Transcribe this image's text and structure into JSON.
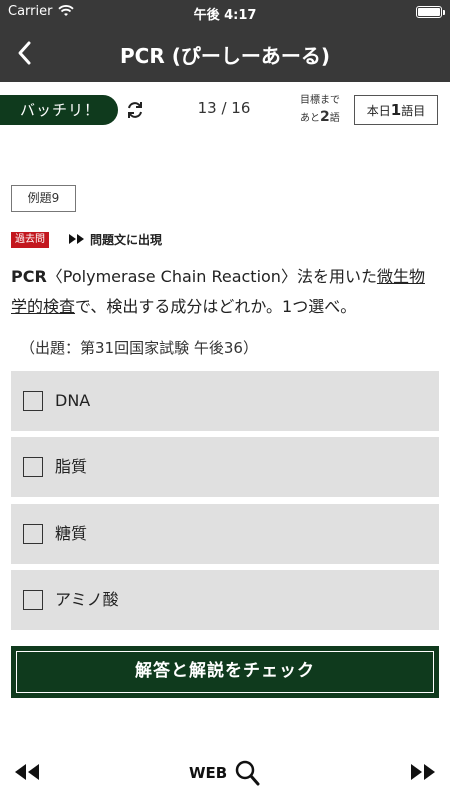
{
  "status_bar": {
    "carrier": "Carrier",
    "time": "午後 4:17"
  },
  "nav": {
    "title": "PCR (ぴーしーあーる)"
  },
  "progress": {
    "batchiri_label": "バッチリ！",
    "counter": "13 / 16",
    "goal_line1": "目標まで",
    "goal_prefix": "あと",
    "goal_count": "2",
    "goal_suffix": "語",
    "today_prefix": "本日",
    "today_count": "1",
    "today_suffix": "語目"
  },
  "question": {
    "example_label": "例題9",
    "past_badge": "過去問",
    "shown_label": "問題文に出現",
    "term": "PCR",
    "text_before_underline": "〈Polymerase Chain Reaction〉法を用いた",
    "underlined_text": "微生物学的検査",
    "text_after": "で、検出する成分はどれか。1つ選べ。",
    "source": "（出題：第31回国家試験 午後36）"
  },
  "choices": [
    {
      "label": "DNA"
    },
    {
      "label": "脂質"
    },
    {
      "label": "糖質"
    },
    {
      "label": "アミノ酸"
    }
  ],
  "check_button_label": "解答と解説をチェック",
  "bottom": {
    "web_label": "WEB"
  },
  "colors": {
    "bar": "#393939",
    "accent_green": "#0f3a1d",
    "badge_red": "#c3171e",
    "choice_bg": "#e0e0e0"
  }
}
